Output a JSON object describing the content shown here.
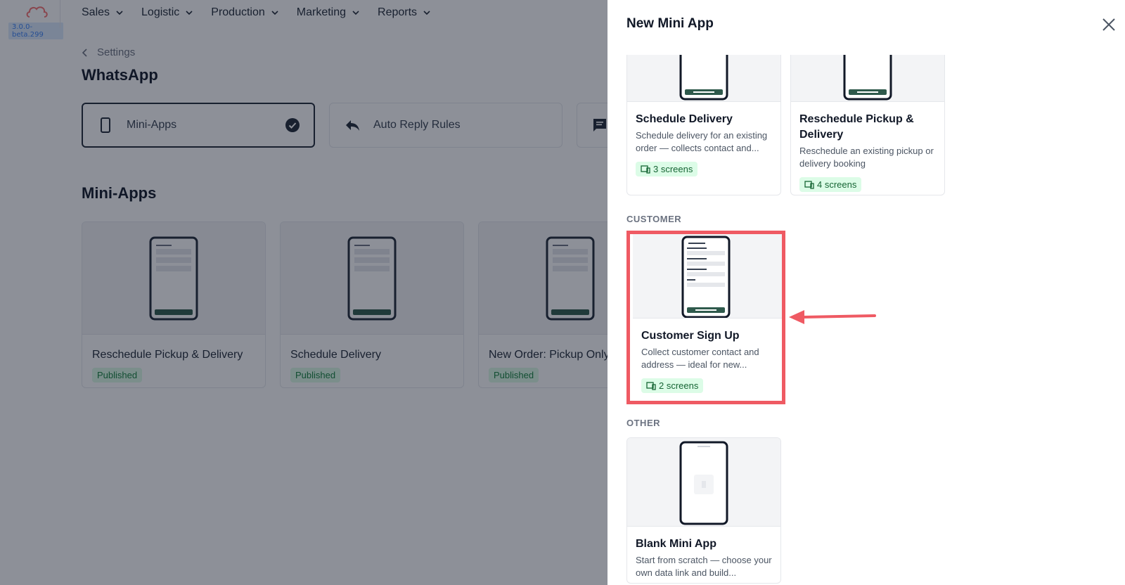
{
  "app": {
    "version": "3.0.0-beta.299",
    "nav": [
      {
        "label": "Sales"
      },
      {
        "label": "Logistic"
      },
      {
        "label": "Production"
      },
      {
        "label": "Marketing"
      },
      {
        "label": "Reports"
      }
    ],
    "breadcrumb": "Settings",
    "page_title": "WhatsApp",
    "tabs": [
      {
        "label": "Mini-Apps",
        "icon": "phone-icon",
        "active": true
      },
      {
        "label": "Auto Reply Rules",
        "icon": "reply-icon",
        "active": false
      },
      {
        "label": "",
        "icon": "chat-icon",
        "active": false
      }
    ],
    "section_title": "Mini-Apps",
    "mini_apps": [
      {
        "name": "Reschedule Pickup & Delivery",
        "status": "Published"
      },
      {
        "name": "Schedule Delivery",
        "status": "Published"
      },
      {
        "name": "New Order: Pickup Only",
        "status": "Published"
      }
    ]
  },
  "drawer": {
    "title": "New Mini App",
    "templates_top": [
      {
        "name": "Schedule Delivery",
        "description": "Schedule delivery for an existing order — collects contact and...",
        "screens": "3 screens"
      },
      {
        "name": "Reschedule Pickup & Delivery",
        "description": "Reschedule an existing pickup or delivery booking",
        "screens": "4 screens"
      }
    ],
    "customer": {
      "label": "CUSTOMER",
      "template": {
        "name": "Customer Sign Up",
        "description": "Collect customer contact and address — ideal for new...",
        "screens": "2 screens"
      }
    },
    "other": {
      "label": "OTHER",
      "template": {
        "name": "Blank Mini App",
        "description": "Start from scratch — choose your own data link and build..."
      }
    }
  },
  "colors": {
    "accent_dark_green": "#2f5a4c",
    "highlight_red": "#ef5a63",
    "badge_green": "#dcfce7"
  }
}
